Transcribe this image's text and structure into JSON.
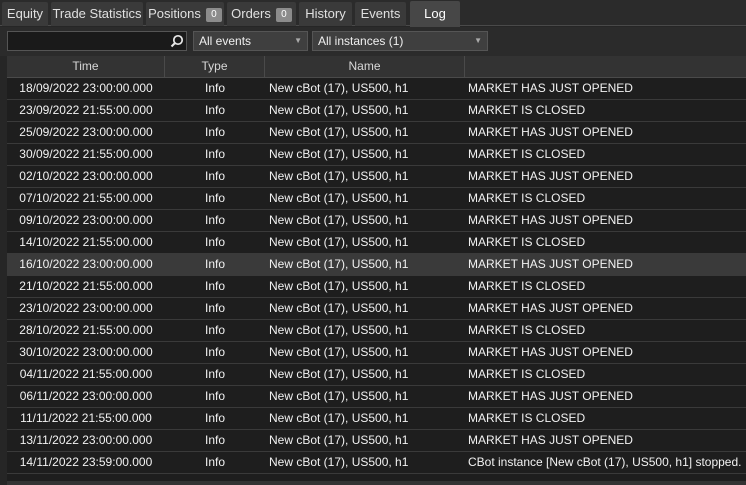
{
  "tabs": [
    {
      "label": "Equity",
      "badge": null
    },
    {
      "label": "Trade Statistics",
      "badge": null
    },
    {
      "label": "Positions",
      "badge": "0"
    },
    {
      "label": "Orders",
      "badge": "0"
    },
    {
      "label": "History",
      "badge": null
    },
    {
      "label": "Events",
      "badge": null
    },
    {
      "label": "Log",
      "badge": null,
      "active": true
    }
  ],
  "toolbar": {
    "search_value": "",
    "event_filter": "All events",
    "instance_filter": "All instances (1)"
  },
  "columns": {
    "time": "Time",
    "type": "Type",
    "name": "Name",
    "message": ""
  },
  "rows": [
    {
      "time": "18/09/2022 23:00:00.000",
      "type": "Info",
      "name": "New cBot (17), US500, h1",
      "message": "MARKET HAS JUST OPENED"
    },
    {
      "time": "23/09/2022 21:55:00.000",
      "type": "Info",
      "name": "New cBot (17), US500, h1",
      "message": "MARKET IS CLOSED"
    },
    {
      "time": "25/09/2022 23:00:00.000",
      "type": "Info",
      "name": "New cBot (17), US500, h1",
      "message": "MARKET HAS JUST OPENED"
    },
    {
      "time": "30/09/2022 21:55:00.000",
      "type": "Info",
      "name": "New cBot (17), US500, h1",
      "message": "MARKET IS CLOSED"
    },
    {
      "time": "02/10/2022 23:00:00.000",
      "type": "Info",
      "name": "New cBot (17), US500, h1",
      "message": "MARKET HAS JUST OPENED"
    },
    {
      "time": "07/10/2022 21:55:00.000",
      "type": "Info",
      "name": "New cBot (17), US500, h1",
      "message": "MARKET IS CLOSED"
    },
    {
      "time": "09/10/2022 23:00:00.000",
      "type": "Info",
      "name": "New cBot (17), US500, h1",
      "message": "MARKET HAS JUST OPENED"
    },
    {
      "time": "14/10/2022 21:55:00.000",
      "type": "Info",
      "name": "New cBot (17), US500, h1",
      "message": "MARKET IS CLOSED"
    },
    {
      "time": "16/10/2022 23:00:00.000",
      "type": "Info",
      "name": "New cBot (17), US500, h1",
      "message": "MARKET HAS JUST OPENED",
      "selected": true
    },
    {
      "time": "21/10/2022 21:55:00.000",
      "type": "Info",
      "name": "New cBot (17), US500, h1",
      "message": "MARKET IS CLOSED"
    },
    {
      "time": "23/10/2022 23:00:00.000",
      "type": "Info",
      "name": "New cBot (17), US500, h1",
      "message": "MARKET HAS JUST OPENED"
    },
    {
      "time": "28/10/2022 21:55:00.000",
      "type": "Info",
      "name": "New cBot (17), US500, h1",
      "message": "MARKET IS CLOSED"
    },
    {
      "time": "30/10/2022 23:00:00.000",
      "type": "Info",
      "name": "New cBot (17), US500, h1",
      "message": "MARKET HAS JUST OPENED"
    },
    {
      "time": "04/11/2022 21:55:00.000",
      "type": "Info",
      "name": "New cBot (17), US500, h1",
      "message": "MARKET IS CLOSED"
    },
    {
      "time": "06/11/2022 23:00:00.000",
      "type": "Info",
      "name": "New cBot (17), US500, h1",
      "message": "MARKET HAS JUST OPENED"
    },
    {
      "time": "11/11/2022 21:55:00.000",
      "type": "Info",
      "name": "New cBot (17), US500, h1",
      "message": "MARKET IS CLOSED"
    },
    {
      "time": "13/11/2022 23:00:00.000",
      "type": "Info",
      "name": "New cBot (17), US500, h1",
      "message": "MARKET HAS JUST OPENED"
    },
    {
      "time": "14/11/2022 23:59:00.000",
      "type": "Info",
      "name": "New cBot (17), US500, h1",
      "message": "CBot instance [New cBot (17), US500, h1] stopped."
    }
  ]
}
